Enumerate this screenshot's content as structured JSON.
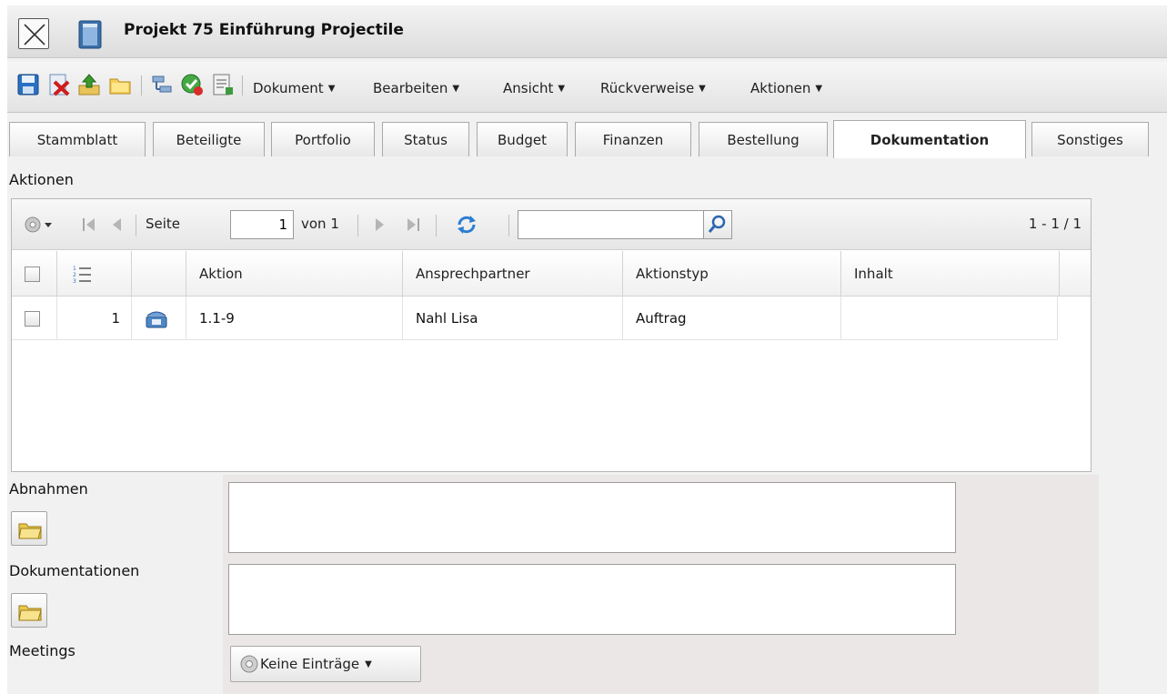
{
  "window": {
    "title": "Projekt 75 Einführung Projectile",
    "close_icon": "close-icon",
    "doc_icon": "document-icon"
  },
  "toolbar": {
    "icons": [
      "save-icon",
      "delete-document-icon",
      "upload-icon",
      "open-folder-icon",
      "hierarchy-icon",
      "approve-icon",
      "report-icon"
    ],
    "menus": [
      {
        "label": "Dokument"
      },
      {
        "label": "Bearbeiten"
      },
      {
        "label": "Ansicht"
      },
      {
        "label": "Rückverweise"
      },
      {
        "label": "Aktionen"
      }
    ]
  },
  "tabs": [
    {
      "label": "Stammblatt"
    },
    {
      "label": "Beteiligte"
    },
    {
      "label": "Portfolio"
    },
    {
      "label": "Status"
    },
    {
      "label": "Budget"
    },
    {
      "label": "Finanzen"
    },
    {
      "label": "Bestellung"
    },
    {
      "label": "Dokumentation",
      "active": true
    },
    {
      "label": "Sonstiges"
    }
  ],
  "aktionen": {
    "section_label": "Aktionen",
    "pager": {
      "page_label": "Seite",
      "page_value": "1",
      "of_label": "von 1",
      "search_value": "",
      "count": "1 - 1 / 1"
    },
    "columns": [
      "Aktion",
      "Ansprechpartner",
      "Aktionstyp",
      "Inhalt"
    ],
    "rows": [
      {
        "num": "1",
        "icon": "phone-icon",
        "aktion": "1.1-9",
        "ansprechpartner": "Nahl Lisa",
        "aktionstyp": "Auftrag",
        "inhalt": ""
      }
    ]
  },
  "abnahmen": {
    "label": "Abnahmen",
    "value": ""
  },
  "dokumentationen": {
    "label": "Dokumentationen",
    "value": ""
  },
  "meetings": {
    "label": "Meetings",
    "button_label": "Keine Einträge"
  },
  "colors": {
    "active_tab_bg": "#ffffff",
    "form_strip_bg": "#ebe7e7",
    "panel_bg": "#f1f1f1"
  }
}
